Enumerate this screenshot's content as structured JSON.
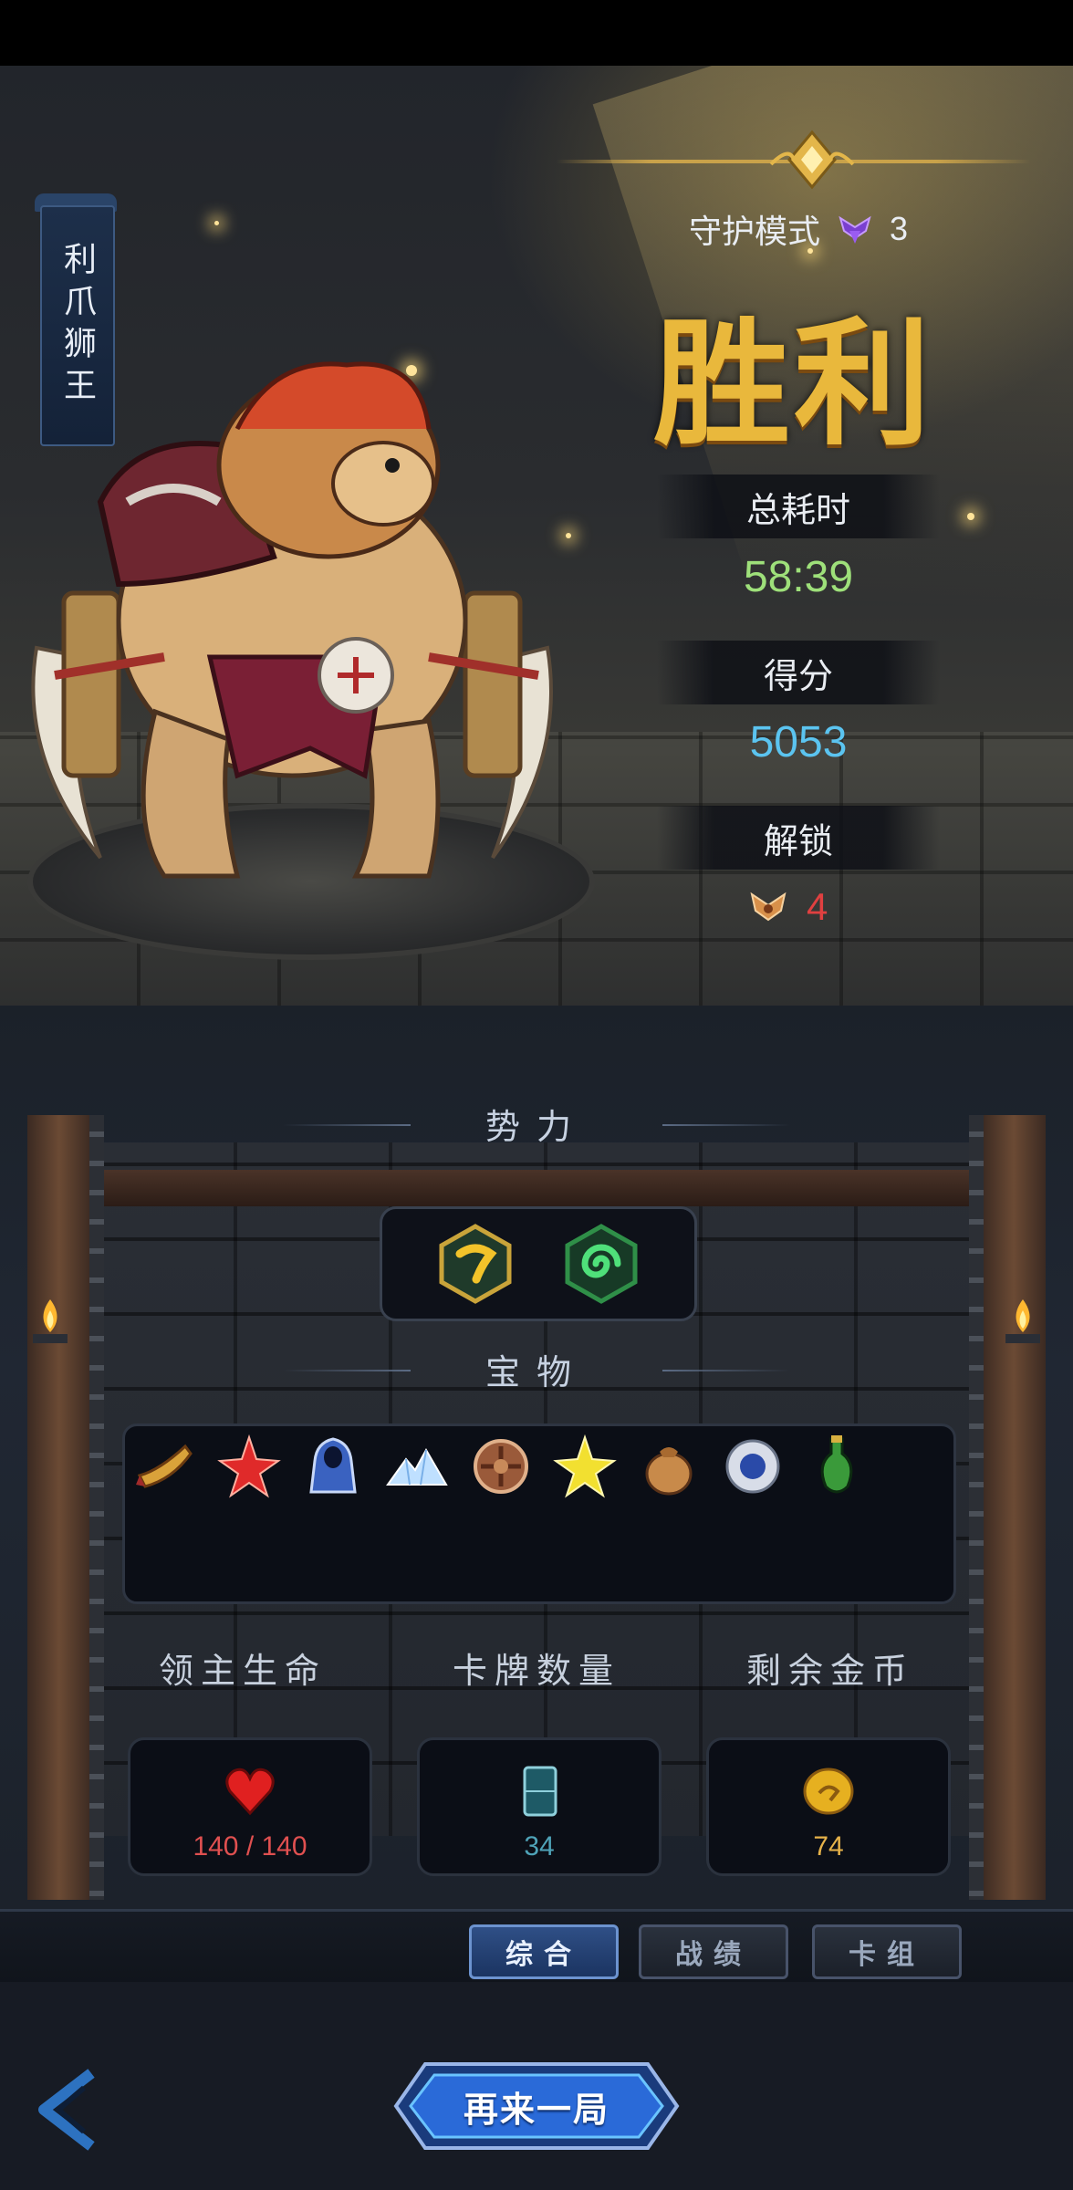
{
  "hero": {
    "name": "利爪狮王",
    "mode_label": "守护模式",
    "mode_level": "3",
    "result": "胜利",
    "total_time_label": "总耗时",
    "total_time": "58:39",
    "score_label": "得分",
    "score": "5053",
    "unlock_label": "解锁",
    "unlock_value": "4"
  },
  "sections": {
    "faction": "势力",
    "treasure": "宝物"
  },
  "factions": [
    "yellow-hook-faction-icon",
    "green-swirl-faction-icon"
  ],
  "treasures": [
    "horn-icon",
    "red-star-gem-icon",
    "blue-cloak-icon",
    "ice-crystal-icon",
    "bronze-shield-icon",
    "gold-star-icon",
    "sack-icon",
    "round-shield-icon",
    "green-potion-icon"
  ],
  "summary": {
    "lord_hp_label": "领主生命",
    "lord_hp": "140 / 140",
    "card_count_label": "卡牌数量",
    "card_count": "34",
    "gold_label": "剩余金币",
    "gold": "74"
  },
  "tabs": [
    "综合",
    "战绩",
    "卡组"
  ],
  "active_tab": "综合",
  "buttons": {
    "play_again": "再来一局"
  },
  "colors": {
    "victory_gold": "#e9b83c",
    "time_green": "#9ee07a",
    "score_blue": "#5bc4f0",
    "unlock_red": "#e04040",
    "hp_red": "#e05050",
    "card_teal": "#4fa3b8",
    "gold_yellow": "#e6b24a"
  }
}
